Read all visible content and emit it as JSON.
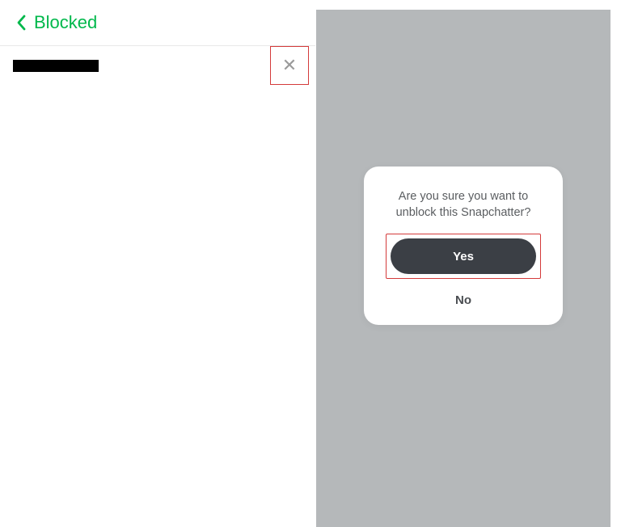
{
  "left": {
    "title": "Blocked",
    "close_icon": "✕"
  },
  "dialog": {
    "line1": "Are you sure you want to",
    "line2": "unblock this Snapchatter?",
    "yes": "Yes",
    "no": "No"
  }
}
